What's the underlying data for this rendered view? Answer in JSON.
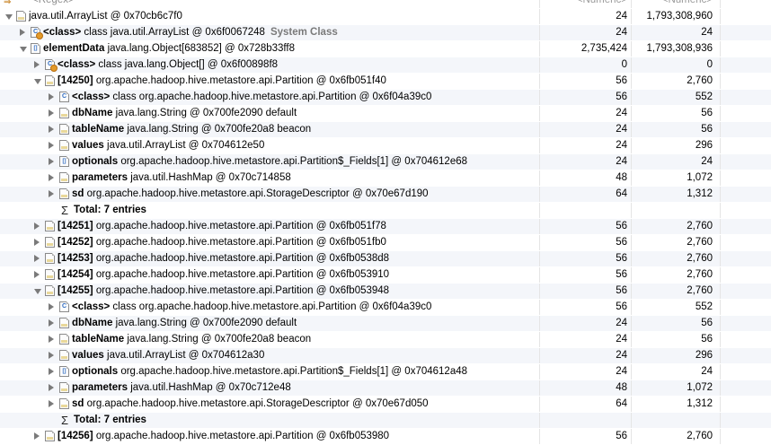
{
  "columns": {
    "regex_placeholder": "<Regex>",
    "col2_placeholder": "<Numeric>",
    "col3_placeholder": "<Numeric>"
  },
  "rows": [
    {
      "indent": 0,
      "twisty": "open",
      "icon": "file",
      "bold": "",
      "text": "java.util.ArrayList @ 0x70cb6c7f0",
      "extra": "",
      "shallow": "24",
      "retained": "1,793,308,960"
    },
    {
      "indent": 1,
      "twisty": "closed",
      "icon": "cls",
      "badge": true,
      "bold": "<class>",
      "text": " class java.util.ArrayList @ 0x6f0067248",
      "extra": "System Class",
      "shallow": "24",
      "retained": "24"
    },
    {
      "indent": 1,
      "twisty": "open",
      "icon": "arr",
      "bold": "elementData",
      "text": " java.lang.Object[683852] @ 0x728b33ff8",
      "extra": "",
      "shallow": "2,735,424",
      "retained": "1,793,308,936"
    },
    {
      "indent": 2,
      "twisty": "closed",
      "icon": "cls",
      "badge": true,
      "bold": "<class>",
      "text": " class java.lang.Object[] @ 0x6f00898f8",
      "extra": "",
      "shallow": "0",
      "retained": "0"
    },
    {
      "indent": 2,
      "twisty": "open",
      "icon": "file",
      "bold": "[14250]",
      "text": " org.apache.hadoop.hive.metastore.api.Partition @ 0x6fb051f40",
      "extra": "",
      "shallow": "56",
      "retained": "2,760"
    },
    {
      "indent": 3,
      "twisty": "closed",
      "icon": "cls",
      "bold": "<class>",
      "text": " class org.apache.hadoop.hive.metastore.api.Partition @ 0x6f04a39c0",
      "extra": "",
      "shallow": "56",
      "retained": "552"
    },
    {
      "indent": 3,
      "twisty": "closed",
      "icon": "file",
      "bold": "dbName",
      "text": " java.lang.String @ 0x700fe2090  default",
      "extra": "",
      "shallow": "24",
      "retained": "56"
    },
    {
      "indent": 3,
      "twisty": "closed",
      "icon": "file",
      "bold": "tableName",
      "text": " java.lang.String @ 0x700fe20a8  beacon",
      "extra": "",
      "shallow": "24",
      "retained": "56"
    },
    {
      "indent": 3,
      "twisty": "closed",
      "icon": "file",
      "bold": "values",
      "text": " java.util.ArrayList @ 0x704612e50",
      "extra": "",
      "shallow": "24",
      "retained": "296"
    },
    {
      "indent": 3,
      "twisty": "closed",
      "icon": "arr",
      "bold": "optionals",
      "text": " org.apache.hadoop.hive.metastore.api.Partition$_Fields[1] @ 0x704612e68",
      "extra": "",
      "shallow": "24",
      "retained": "24"
    },
    {
      "indent": 3,
      "twisty": "closed",
      "icon": "file",
      "bold": "parameters",
      "text": " java.util.HashMap @ 0x70c714858",
      "extra": "",
      "shallow": "48",
      "retained": "1,072"
    },
    {
      "indent": 3,
      "twisty": "closed",
      "icon": "file",
      "bold": "sd",
      "text": " org.apache.hadoop.hive.metastore.api.StorageDescriptor @ 0x70e67d190",
      "extra": "",
      "shallow": "64",
      "retained": "1,312"
    },
    {
      "indent": 3,
      "twisty": "none",
      "icon": "sigma",
      "bold": "Total: 7 entries",
      "text": "",
      "extra": "",
      "shallow": "",
      "retained": ""
    },
    {
      "indent": 2,
      "twisty": "closed",
      "icon": "file",
      "bold": "[14251]",
      "text": " org.apache.hadoop.hive.metastore.api.Partition @ 0x6fb051f78",
      "extra": "",
      "shallow": "56",
      "retained": "2,760"
    },
    {
      "indent": 2,
      "twisty": "closed",
      "icon": "file",
      "bold": "[14252]",
      "text": " org.apache.hadoop.hive.metastore.api.Partition @ 0x6fb051fb0",
      "extra": "",
      "shallow": "56",
      "retained": "2,760"
    },
    {
      "indent": 2,
      "twisty": "closed",
      "icon": "file",
      "bold": "[14253]",
      "text": " org.apache.hadoop.hive.metastore.api.Partition @ 0x6fb0538d8",
      "extra": "",
      "shallow": "56",
      "retained": "2,760"
    },
    {
      "indent": 2,
      "twisty": "closed",
      "icon": "file",
      "bold": "[14254]",
      "text": " org.apache.hadoop.hive.metastore.api.Partition @ 0x6fb053910",
      "extra": "",
      "shallow": "56",
      "retained": "2,760"
    },
    {
      "indent": 2,
      "twisty": "open",
      "icon": "file",
      "bold": "[14255]",
      "text": " org.apache.hadoop.hive.metastore.api.Partition @ 0x6fb053948",
      "extra": "",
      "shallow": "56",
      "retained": "2,760"
    },
    {
      "indent": 3,
      "twisty": "closed",
      "icon": "cls",
      "bold": "<class>",
      "text": " class org.apache.hadoop.hive.metastore.api.Partition @ 0x6f04a39c0",
      "extra": "",
      "shallow": "56",
      "retained": "552"
    },
    {
      "indent": 3,
      "twisty": "closed",
      "icon": "file",
      "bold": "dbName",
      "text": " java.lang.String @ 0x700fe2090  default",
      "extra": "",
      "shallow": "24",
      "retained": "56"
    },
    {
      "indent": 3,
      "twisty": "closed",
      "icon": "file",
      "bold": "tableName",
      "text": " java.lang.String @ 0x700fe20a8  beacon",
      "extra": "",
      "shallow": "24",
      "retained": "56"
    },
    {
      "indent": 3,
      "twisty": "closed",
      "icon": "file",
      "bold": "values",
      "text": " java.util.ArrayList @ 0x704612a30",
      "extra": "",
      "shallow": "24",
      "retained": "296"
    },
    {
      "indent": 3,
      "twisty": "closed",
      "icon": "arr",
      "bold": "optionals",
      "text": " org.apache.hadoop.hive.metastore.api.Partition$_Fields[1] @ 0x704612a48",
      "extra": "",
      "shallow": "24",
      "retained": "24"
    },
    {
      "indent": 3,
      "twisty": "closed",
      "icon": "file",
      "bold": "parameters",
      "text": " java.util.HashMap @ 0x70c712e48",
      "extra": "",
      "shallow": "48",
      "retained": "1,072"
    },
    {
      "indent": 3,
      "twisty": "closed",
      "icon": "file",
      "bold": "sd",
      "text": " org.apache.hadoop.hive.metastore.api.StorageDescriptor @ 0x70e67d050",
      "extra": "",
      "shallow": "64",
      "retained": "1,312"
    },
    {
      "indent": 3,
      "twisty": "none",
      "icon": "sigma",
      "bold": "Total: 7 entries",
      "text": "",
      "extra": "",
      "shallow": "",
      "retained": ""
    },
    {
      "indent": 2,
      "twisty": "closed",
      "icon": "file",
      "bold": "[14256]",
      "text": " org.apache.hadoop.hive.metastore.api.Partition @ 0x6fb053980",
      "extra": "",
      "shallow": "56",
      "retained": "2,760"
    }
  ]
}
